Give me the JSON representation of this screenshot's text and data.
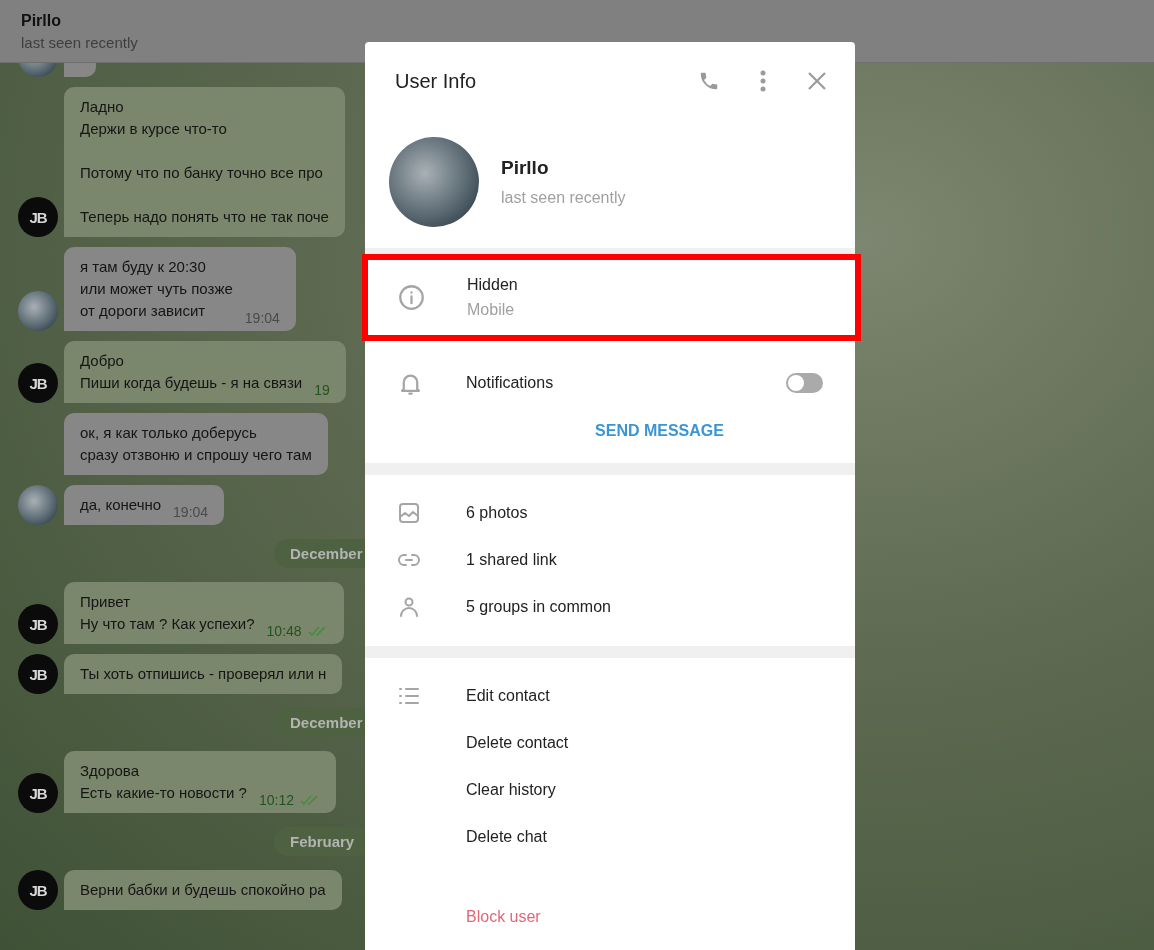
{
  "chat": {
    "title": "Pirllo",
    "status": "last seen recently",
    "messages": [
      {
        "kind": "message",
        "outgoing": false,
        "avatar": {
          "kind": "photo"
        }
      },
      {
        "kind": "message",
        "outgoing": true,
        "avatar": {
          "kind": "logo",
          "text": "JB"
        },
        "paragraphs": [
          [
            "Ладно",
            "Держи в курсе что-то"
          ],
          [
            "Потому что по банку точно все про"
          ],
          [
            "Теперь надо понять что не так поче"
          ]
        ]
      },
      {
        "kind": "message",
        "outgoing": false,
        "avatar": {
          "kind": "photo"
        },
        "lines": [
          "я там буду к 20:30",
          "или может чуть позже",
          "от дороги зависит"
        ],
        "time": "19:04"
      },
      {
        "kind": "message",
        "outgoing": true,
        "avatar": {
          "kind": "logo",
          "text": "JB"
        },
        "lines": [
          "Добро",
          "Пиши когда будешь - я на связи"
        ],
        "time": "19"
      },
      {
        "kind": "message",
        "outgoing": false,
        "lines": [
          "ок, я как только доберусь",
          "сразу отзвоню и спрошу чего там"
        ]
      },
      {
        "kind": "message",
        "outgoing": false,
        "avatar": {
          "kind": "photo"
        },
        "lines": [
          "да, конечно"
        ],
        "time": "19:04"
      },
      {
        "kind": "date",
        "label": "December"
      },
      {
        "kind": "message",
        "outgoing": true,
        "avatar": {
          "kind": "logo",
          "text": "JB"
        },
        "lines": [
          "Привет",
          "Ну что там ? Как успехи?"
        ],
        "time": "10:48",
        "read": true
      },
      {
        "kind": "message",
        "outgoing": true,
        "avatar": {
          "kind": "logo",
          "text": "JB"
        },
        "lines": [
          "Ты хоть отпишись - проверял или н"
        ]
      },
      {
        "kind": "date",
        "label": "December"
      },
      {
        "kind": "message",
        "outgoing": true,
        "avatar": {
          "kind": "logo",
          "text": "JB"
        },
        "lines": [
          "Здорова",
          "Есть какие-то новости ?"
        ],
        "time": "10:12",
        "read": true
      },
      {
        "kind": "date",
        "label": "February"
      },
      {
        "kind": "message",
        "outgoing": true,
        "avatar": {
          "kind": "logo",
          "text": "JB"
        },
        "lines": [
          "Верни бабки и будешь спокойно ра"
        ]
      }
    ]
  },
  "user_info": {
    "title": "User Info",
    "name": "Pirllo",
    "status": "last seen recently",
    "phone": {
      "value": "Hidden",
      "label": "Mobile",
      "highlighted": true
    },
    "notifications": {
      "label": "Notifications",
      "on": false
    },
    "send_message": "SEND MESSAGE",
    "media": [
      {
        "kind": "photos",
        "label": "6 photos"
      },
      {
        "kind": "links",
        "label": "1 shared link"
      },
      {
        "kind": "groups",
        "label": "5 groups in common"
      }
    ],
    "actions": [
      {
        "label": "Edit contact",
        "danger": false
      },
      {
        "label": "Delete contact",
        "danger": false
      },
      {
        "label": "Clear history",
        "danger": false
      },
      {
        "label": "Delete chat",
        "danger": false
      },
      {
        "label": "Block user",
        "danger": true
      }
    ]
  }
}
